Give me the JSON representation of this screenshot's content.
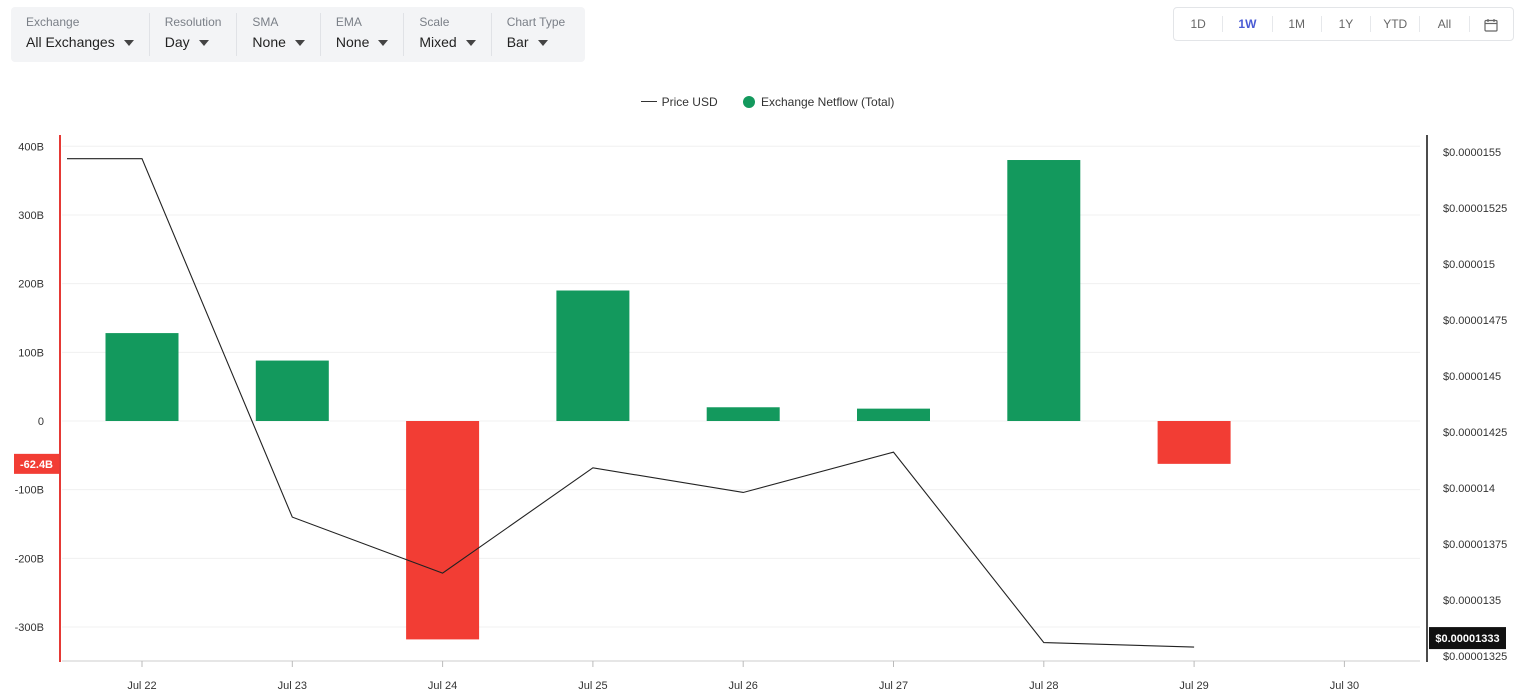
{
  "filters": [
    {
      "label": "Exchange",
      "value": "All Exchanges"
    },
    {
      "label": "Resolution",
      "value": "Day"
    },
    {
      "label": "SMA",
      "value": "None"
    },
    {
      "label": "EMA",
      "value": "None"
    },
    {
      "label": "Scale",
      "value": "Mixed"
    },
    {
      "label": "Chart Type",
      "value": "Bar"
    }
  ],
  "ranges": {
    "items": [
      "1D",
      "1W",
      "1M",
      "1Y",
      "YTD",
      "All"
    ],
    "active": "1W",
    "calendar_icon": "calendar-icon"
  },
  "colors": {
    "positive": "#13995d",
    "negative": "#f23d34",
    "price_line": "#222222",
    "left_axis": "#e53935"
  },
  "chart_data": {
    "type": "bar",
    "categories": [
      "Jul 22",
      "Jul 23",
      "Jul 24",
      "Jul 25",
      "Jul 26",
      "Jul 27",
      "Jul 28",
      "Jul 29",
      "Jul 30"
    ],
    "series": [
      {
        "name": "Exchange Netflow (Total)",
        "type": "bar",
        "axis": "left",
        "values": [
          128,
          88,
          -318,
          190,
          20,
          18,
          380,
          -62.4,
          null
        ]
      },
      {
        "name": "Price USD",
        "type": "line",
        "axis": "right",
        "values": [
          1.547e-05,
          1.387e-05,
          1.362e-05,
          1.409e-05,
          1.398e-05,
          1.416e-05,
          1.331e-05,
          1.329e-05,
          null
        ]
      }
    ],
    "left_axis": {
      "ticks": [
        400,
        300,
        200,
        100,
        0,
        -100,
        -200,
        -300
      ],
      "tick_labels": [
        "400B",
        "300B",
        "200B",
        "100B",
        "0",
        "-100B",
        "-200B",
        "-300B"
      ],
      "ylim": [
        -350,
        400
      ]
    },
    "right_axis": {
      "ticks": [
        1.55e-05,
        1.525e-05,
        1.5e-05,
        1.475e-05,
        1.45e-05,
        1.425e-05,
        1.4e-05,
        1.375e-05,
        1.35e-05,
        1.325e-05
      ],
      "tick_labels": [
        "$0.0000155",
        "$0.00001525",
        "$0.000015",
        "$0.00001475",
        "$0.0000145",
        "$0.00001425",
        "$0.000014",
        "$0.00001375",
        "$0.0000135",
        "$0.00001325"
      ],
      "ylim": [
        1.325e-05,
        1.55e-05
      ]
    },
    "markers": {
      "left_label": "-62.4B",
      "right_label": "$0.00001333"
    },
    "legend": {
      "position": "top-center",
      "items": [
        "Price USD",
        "Exchange Netflow (Total)"
      ]
    },
    "grid": true
  }
}
